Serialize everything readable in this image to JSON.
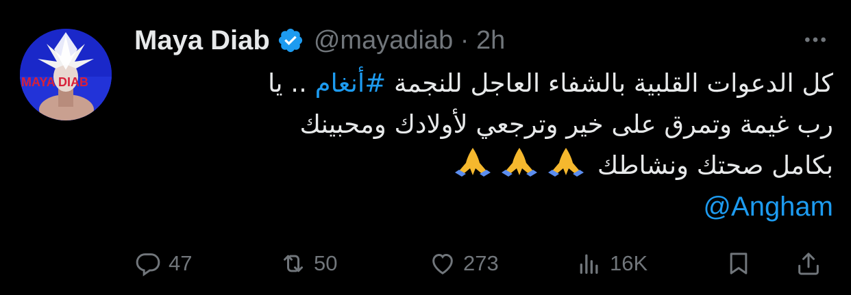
{
  "tweet": {
    "author_name": "Maya Diab",
    "handle_time": "@mayadiab · 2h",
    "avatar_text": "MAYA DIAB",
    "body_line1_a": "كل الدعوات القلبية بالشفاء العاجل للنجمة",
    "hashtag": "#أنغام",
    "body_line1_b": " .. يا",
    "body_line2": "رب غيمة وتمرق على خير وترجعي لأولادك ومحبينك",
    "body_line3": "بكامل صحتك ونشاطك",
    "emoji": [
      "folded-hands",
      "folded-hands",
      "folded-hands"
    ],
    "mention": "@Angham"
  },
  "actions": {
    "replies": "47",
    "reposts": "50",
    "likes": "273",
    "views": "16K"
  },
  "colors": {
    "background": "#000000",
    "text": "#e7e9ea",
    "muted": "#71767b",
    "link": "#1d9bf0",
    "verified": "#1d9bf0"
  }
}
